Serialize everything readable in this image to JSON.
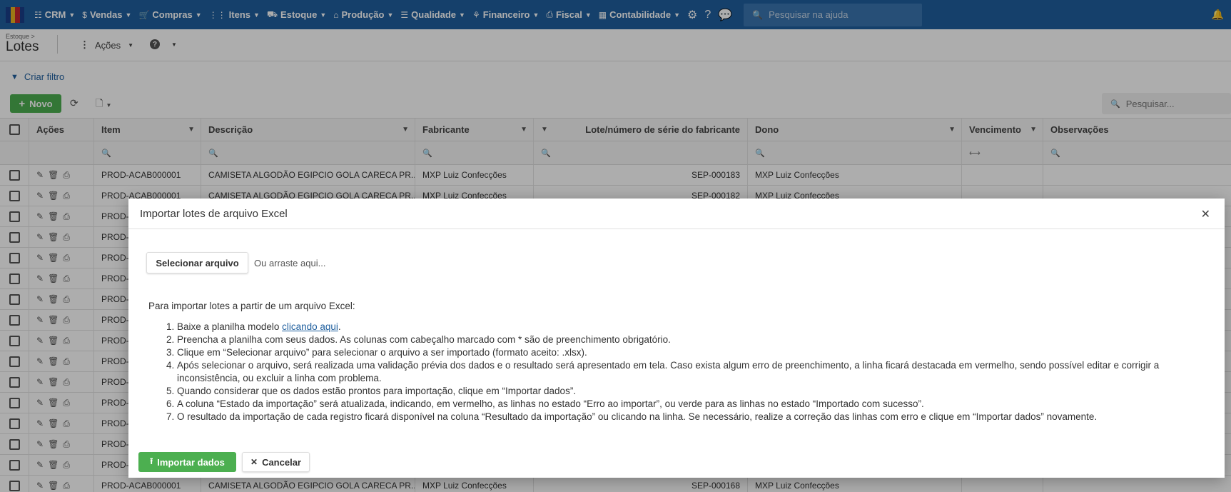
{
  "nav": {
    "items": [
      {
        "icon": "☷",
        "label": "CRM"
      },
      {
        "icon": "$",
        "label": "Vendas"
      },
      {
        "icon": "🛒",
        "label": "Compras"
      },
      {
        "icon": "⋮⋮",
        "label": "Itens"
      },
      {
        "icon": "⛟",
        "label": "Estoque"
      },
      {
        "icon": "⌂",
        "label": "Produção"
      },
      {
        "icon": "☰",
        "label": "Qualidade"
      },
      {
        "icon": "⚘",
        "label": "Financeiro"
      },
      {
        "icon": "⎙",
        "label": "Fiscal"
      },
      {
        "icon": "▦",
        "label": "Contabilidade"
      }
    ],
    "search_placeholder": "Pesquisar na ajuda"
  },
  "page": {
    "breadcrumb": "Estoque >",
    "title": "Lotes",
    "actions_label": "Ações",
    "create_filter": "Criar filtro",
    "new_button": "Novo",
    "grid_search_placeholder": "Pesquisar..."
  },
  "grid": {
    "headers": {
      "acoes": "Ações",
      "item": "Item",
      "descricao": "Descrição",
      "fabricante": "Fabricante",
      "lote": "Lote/número de série do fabricante",
      "dono": "Dono",
      "vencimento": "Vencimento",
      "observacoes": "Observações"
    },
    "rows": [
      {
        "item": "PROD-ACAB000001",
        "descricao": "CAMISETA ALGODÃO EGIPCIO GOLA CARECA PR...",
        "fabricante": "MXP Luiz Confecções",
        "lote": "SEP-000183",
        "dono": "MXP Luiz Confecções"
      },
      {
        "item": "PROD-ACAB000001",
        "descricao": "CAMISETA ALGODÃO EGIPCIO GOLA CARECA PR...",
        "fabricante": "MXP Luiz Confecções",
        "lote": "SEP-000182",
        "dono": "MXP Luiz Confecções"
      },
      {
        "item": "PROD-A",
        "descricao": "",
        "fabricante": "",
        "lote": "",
        "dono": ""
      },
      {
        "item": "PROD-A",
        "descricao": "",
        "fabricante": "",
        "lote": "",
        "dono": ""
      },
      {
        "item": "PROD-A",
        "descricao": "",
        "fabricante": "",
        "lote": "",
        "dono": ""
      },
      {
        "item": "PROD-A",
        "descricao": "",
        "fabricante": "",
        "lote": "",
        "dono": ""
      },
      {
        "item": "PROD-A",
        "descricao": "",
        "fabricante": "",
        "lote": "",
        "dono": ""
      },
      {
        "item": "PROD-A",
        "descricao": "",
        "fabricante": "",
        "lote": "",
        "dono": ""
      },
      {
        "item": "PROD-A",
        "descricao": "",
        "fabricante": "",
        "lote": "",
        "dono": ""
      },
      {
        "item": "PROD-A",
        "descricao": "",
        "fabricante": "",
        "lote": "",
        "dono": ""
      },
      {
        "item": "PROD-A",
        "descricao": "",
        "fabricante": "",
        "lote": "",
        "dono": ""
      },
      {
        "item": "PROD-A",
        "descricao": "",
        "fabricante": "",
        "lote": "",
        "dono": ""
      },
      {
        "item": "PROD-A",
        "descricao": "",
        "fabricante": "",
        "lote": "",
        "dono": ""
      },
      {
        "item": "PROD-A",
        "descricao": "",
        "fabricante": "",
        "lote": "",
        "dono": ""
      },
      {
        "item": "PROD-A",
        "descricao": "",
        "fabricante": "",
        "lote": "",
        "dono": ""
      },
      {
        "item": "PROD-ACAB000001",
        "descricao": "CAMISETA ALGODÃO EGIPCIO GOLA CARECA PR...",
        "fabricante": "MXP Luiz Confecções",
        "lote": "SEP-000168",
        "dono": "MXP Luiz Confecções"
      }
    ]
  },
  "modal": {
    "title": "Importar lotes de arquivo Excel",
    "select_file": "Selecionar arquivo",
    "drop_hint": "Ou arraste aqui...",
    "intro": "Para importar lotes a partir de um arquivo Excel:",
    "step1_prefix": "Baixe a planilha modelo ",
    "step1_link": "clicando aqui",
    "step1_suffix": ".",
    "steps": [
      "Preencha a planilha com seus dados. As colunas com cabeçalho marcado com * são de preenchimento obrigatório.",
      "Clique em “Selecionar arquivo” para selecionar o arquivo a ser importado (formato aceito: .xlsx).",
      "Após selecionar o arquivo, será realizada uma validação prévia dos dados e o resultado será apresentado em tela. Caso exista algum erro de preenchimento, a linha ficará destacada em vermelho, sendo possível editar e corrigir a inconsistência, ou excluir a linha com problema.",
      "Quando considerar que os dados estão prontos para importação, clique em “Importar dados”.",
      "A coluna “Estado da importação” será atualizada, indicando, em vermelho, as linhas no estado “Erro ao importar”, ou verde para as linhas no estado “Importado com sucesso”.",
      "O resultado da importação de cada registro ficará disponível na coluna “Resultado da importação” ou clicando na linha. Se necessário, realize a correção das linhas com erro e clique em “Importar dados” novamente."
    ],
    "import_button": "Importar dados",
    "cancel_button": "Cancelar"
  },
  "colors": {
    "nav_bg": "#1f5f9e",
    "primary_green": "#4caf50",
    "link": "#1f5f9e"
  }
}
